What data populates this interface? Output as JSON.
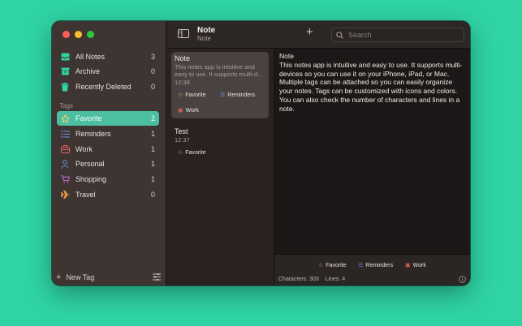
{
  "sidebar": {
    "smart_folders": [
      {
        "label": "All Notes",
        "count": "3",
        "icon": "tray-icon",
        "color": "#2fd3a4"
      },
      {
        "label": "Archive",
        "count": "0",
        "icon": "archive-icon",
        "color": "#2fd3a4"
      },
      {
        "label": "Recently Deleted",
        "count": "0",
        "icon": "trash-icon",
        "color": "#2fd3a4"
      }
    ],
    "tags_header": "Tags",
    "tags": [
      {
        "label": "Favorite",
        "count": "2",
        "icon": "star-icon",
        "color": "#e6b84a",
        "selected": true
      },
      {
        "label": "Reminders",
        "count": "1",
        "icon": "list-icon",
        "color": "#6d8fd9"
      },
      {
        "label": "Work",
        "count": "1",
        "icon": "briefcase-icon",
        "color": "#e0605a"
      },
      {
        "label": "Personal",
        "count": "1",
        "icon": "person-icon",
        "color": "#6d8fd9"
      },
      {
        "label": "Shopping",
        "count": "1",
        "icon": "cart-icon",
        "color": "#c86be0"
      },
      {
        "label": "Travel",
        "count": "0",
        "icon": "airplane-icon",
        "color": "#f0a040"
      }
    ],
    "new_tag_label": "New Tag"
  },
  "toolbar": {
    "title": "Note",
    "subtitle": "Note",
    "search_placeholder": "Search"
  },
  "notes": [
    {
      "title": "Note",
      "preview": "This notes app is intuitive and easy to use. It supports multi-d...",
      "time": "12:38",
      "tags": [
        "Favorite",
        "Reminders",
        "Work"
      ]
    },
    {
      "title": "Test",
      "time": "12:37",
      "tags": [
        "Favorite"
      ]
    }
  ],
  "editor": {
    "body": "Note\nThis notes app is intuitive and easy to use. It supports multi-devices so you can use it on your iPhone, iPad, or Mac.\nMultiple tags can be attached so you can easily organize your notes. Tags can be customized with icons and colors. You can also check the number of characters and lines in a note.",
    "tags": [
      "Favorite",
      "Reminders",
      "Work"
    ],
    "stats": "Characters: 303    Lines: 4"
  }
}
